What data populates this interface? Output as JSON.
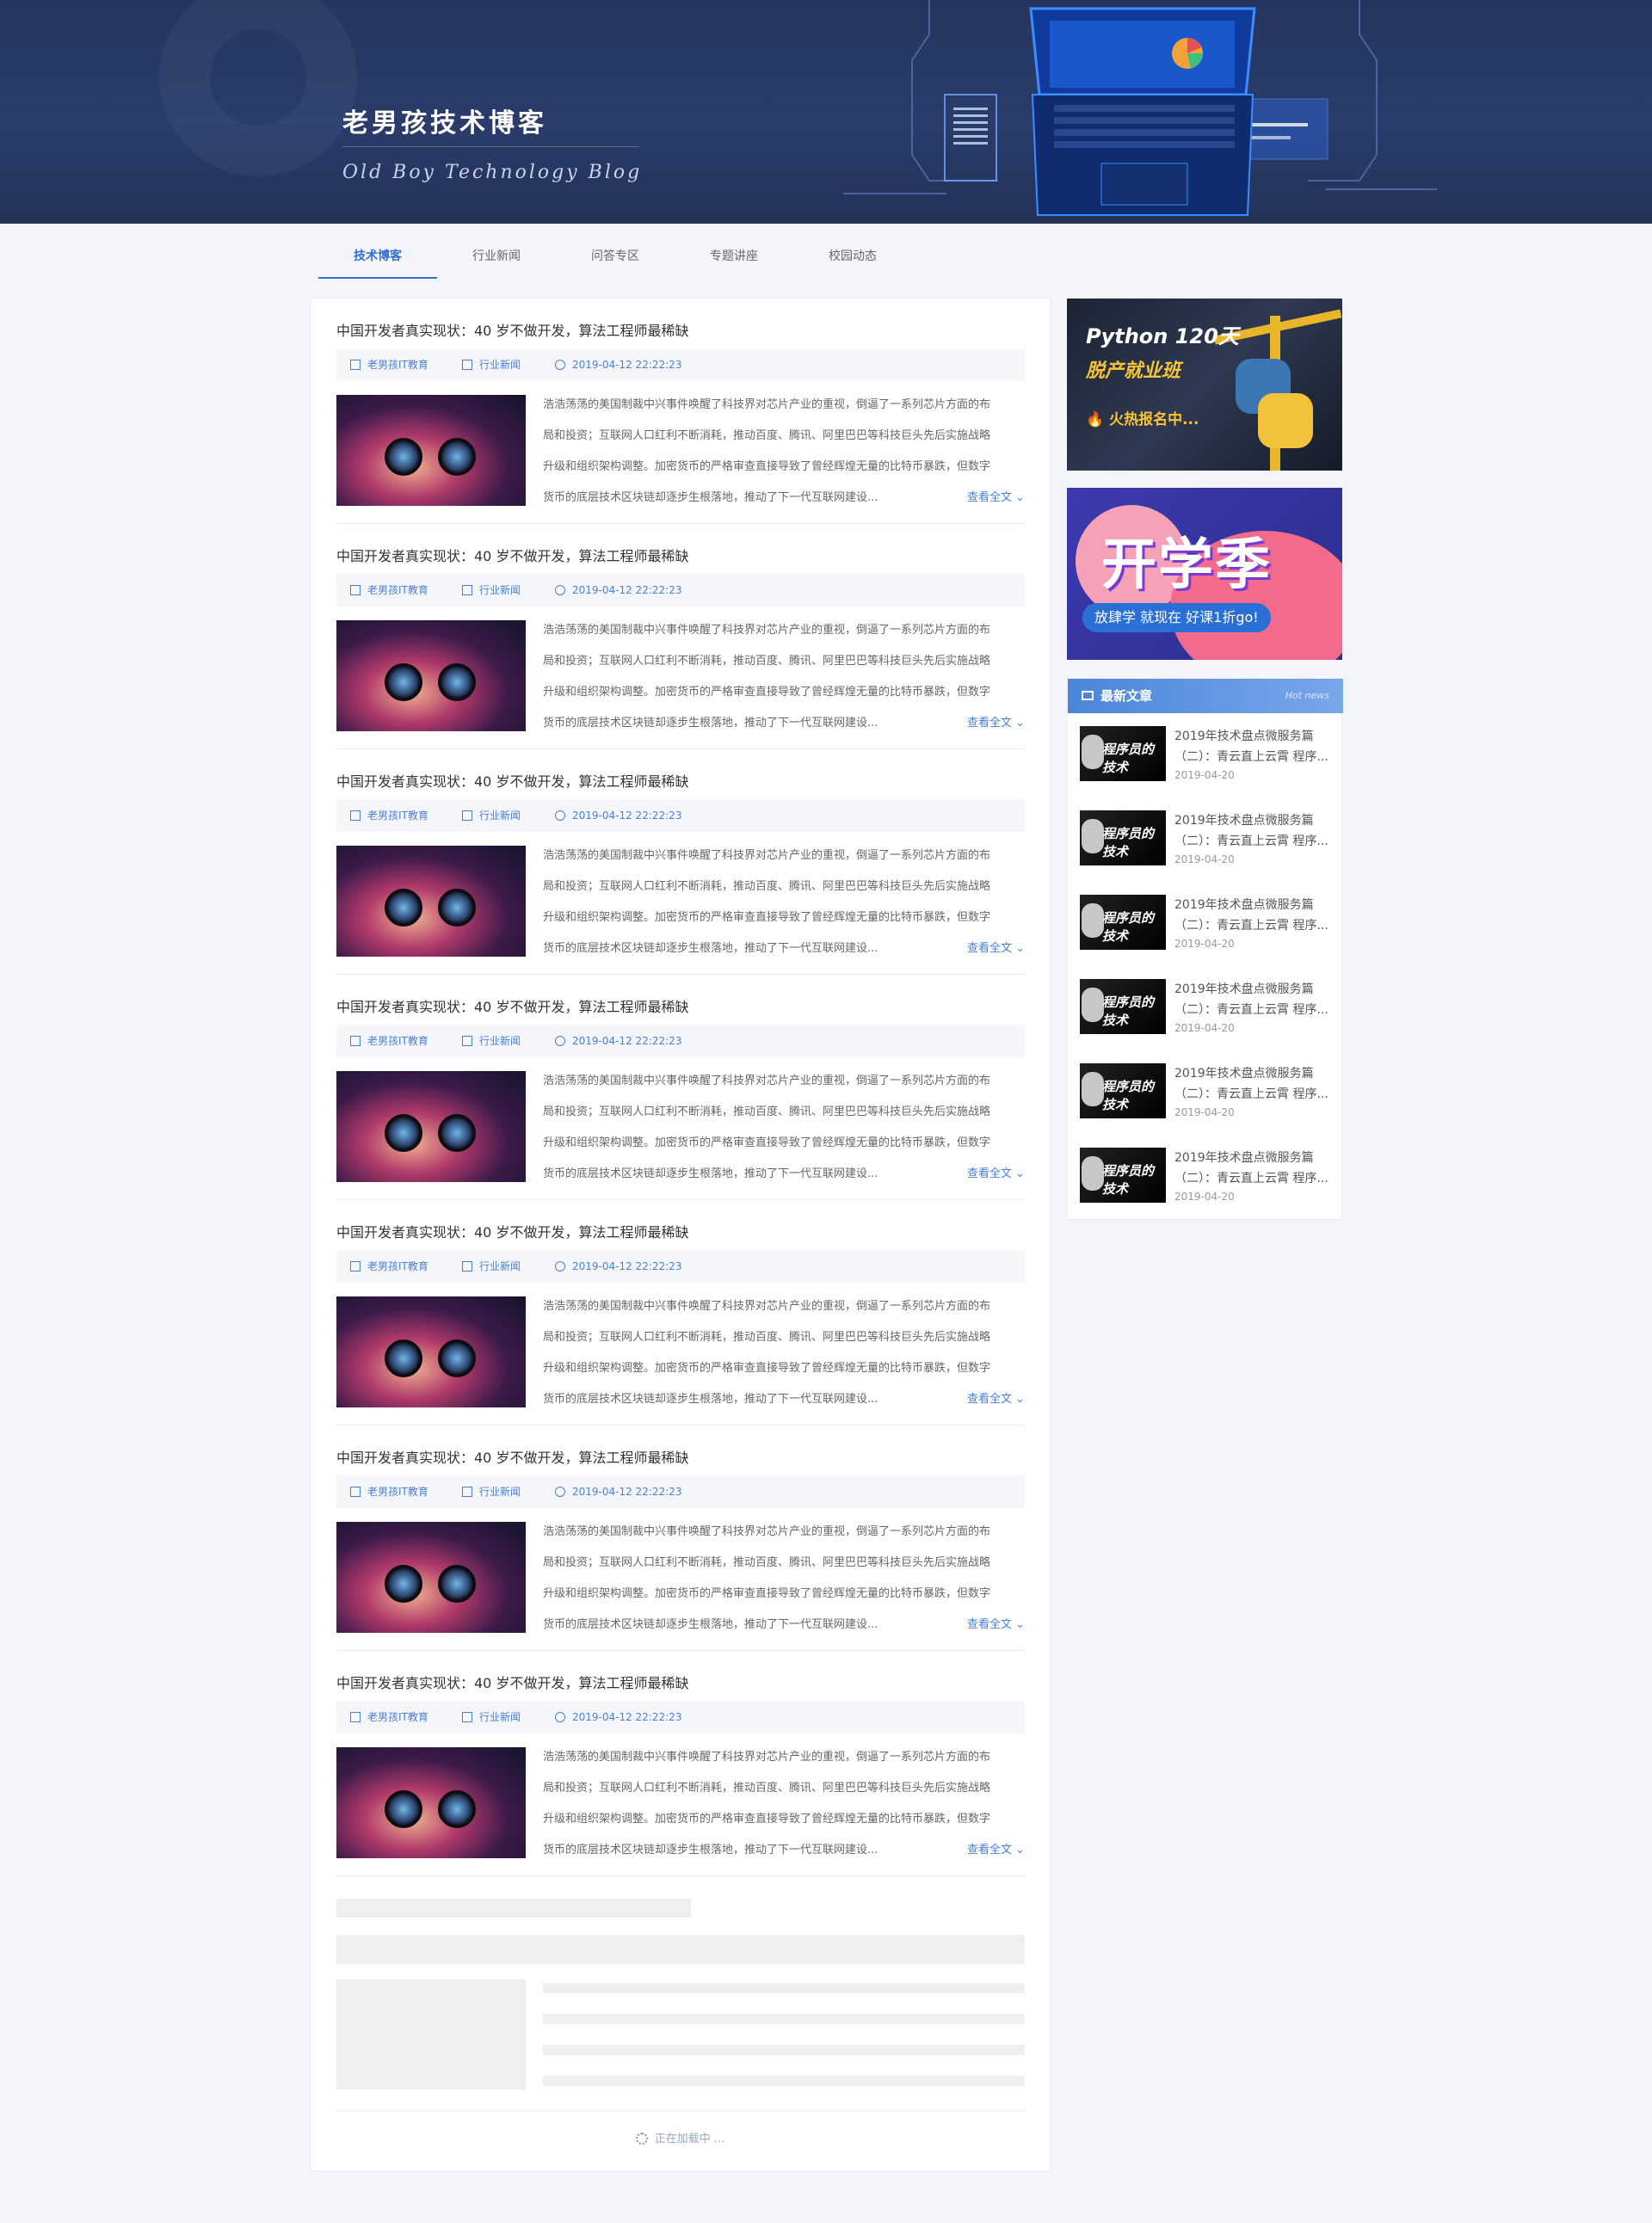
{
  "header": {
    "title": "老男孩技术博客",
    "subtitle": "Old Boy Technology Blog"
  },
  "nav": {
    "items": [
      "技术博客",
      "行业新闻",
      "问答专区",
      "专题讲座",
      "校园动态"
    ],
    "active": "技术博客"
  },
  "articles": [
    {
      "title": "中国开发者真实现状：40 岁不做开发，算法工程师最稀缺",
      "author": "老男孩IT教育",
      "category": "行业新闻",
      "date": "2019-04-12  22:22:23",
      "more": "查看全文",
      "lines": [
        "浩浩荡荡的美国制裁中兴事件唤醒了科技界对芯片产业的重视，倒逼了一系列芯片方面的布",
        "局和投资；互联网人口红利不断消耗，推动百度、腾讯、阿里巴巴等科技巨头先后实施战略",
        "升级和组织架构调整。加密货币的严格审查直接导致了曾经辉煌无量的比特币暴跌，但数字",
        "货币的底层技术区块链却逐步生根落地，推动了下一代互联网建设..."
      ]
    },
    {
      "title": "中国开发者真实现状：40 岁不做开发，算法工程师最稀缺",
      "author": "老男孩IT教育",
      "category": "行业新闻",
      "date": "2019-04-12  22:22:23",
      "more": "查看全文",
      "lines": [
        "浩浩荡荡的美国制裁中兴事件唤醒了科技界对芯片产业的重视，倒逼了一系列芯片方面的布",
        "局和投资；互联网人口红利不断消耗，推动百度、腾讯、阿里巴巴等科技巨头先后实施战略",
        "升级和组织架构调整。加密货币的严格审查直接导致了曾经辉煌无量的比特币暴跌，但数字",
        "货币的底层技术区块链却逐步生根落地，推动了下一代互联网建设..."
      ]
    },
    {
      "title": "中国开发者真实现状：40 岁不做开发，算法工程师最稀缺",
      "author": "老男孩IT教育",
      "category": "行业新闻",
      "date": "2019-04-12  22:22:23",
      "more": "查看全文",
      "lines": [
        "浩浩荡荡的美国制裁中兴事件唤醒了科技界对芯片产业的重视，倒逼了一系列芯片方面的布",
        "局和投资；互联网人口红利不断消耗，推动百度、腾讯、阿里巴巴等科技巨头先后实施战略",
        "升级和组织架构调整。加密货币的严格审查直接导致了曾经辉煌无量的比特币暴跌，但数字",
        "货币的底层技术区块链却逐步生根落地，推动了下一代互联网建设..."
      ]
    },
    {
      "title": "中国开发者真实现状：40 岁不做开发，算法工程师最稀缺",
      "author": "老男孩IT教育",
      "category": "行业新闻",
      "date": "2019-04-12  22:22:23",
      "more": "查看全文",
      "lines": [
        "浩浩荡荡的美国制裁中兴事件唤醒了科技界对芯片产业的重视，倒逼了一系列芯片方面的布",
        "局和投资；互联网人口红利不断消耗，推动百度、腾讯、阿里巴巴等科技巨头先后实施战略",
        "升级和组织架构调整。加密货币的严格审查直接导致了曾经辉煌无量的比特币暴跌，但数字",
        "货币的底层技术区块链却逐步生根落地，推动了下一代互联网建设..."
      ]
    },
    {
      "title": "中国开发者真实现状：40 岁不做开发，算法工程师最稀缺",
      "author": "老男孩IT教育",
      "category": "行业新闻",
      "date": "2019-04-12  22:22:23",
      "more": "查看全文",
      "lines": [
        "浩浩荡荡的美国制裁中兴事件唤醒了科技界对芯片产业的重视，倒逼了一系列芯片方面的布",
        "局和投资；互联网人口红利不断消耗，推动百度、腾讯、阿里巴巴等科技巨头先后实施战略",
        "升级和组织架构调整。加密货币的严格审查直接导致了曾经辉煌无量的比特币暴跌，但数字",
        "货币的底层技术区块链却逐步生根落地，推动了下一代互联网建设..."
      ]
    },
    {
      "title": "中国开发者真实现状：40 岁不做开发，算法工程师最稀缺",
      "author": "老男孩IT教育",
      "category": "行业新闻",
      "date": "2019-04-12  22:22:23",
      "more": "查看全文",
      "lines": [
        "浩浩荡荡的美国制裁中兴事件唤醒了科技界对芯片产业的重视，倒逼了一系列芯片方面的布",
        "局和投资；互联网人口红利不断消耗，推动百度、腾讯、阿里巴巴等科技巨头先后实施战略",
        "升级和组织架构调整。加密货币的严格审查直接导致了曾经辉煌无量的比特币暴跌，但数字",
        "货币的底层技术区块链却逐步生根落地，推动了下一代互联网建设..."
      ]
    },
    {
      "title": "中国开发者真实现状：40 岁不做开发，算法工程师最稀缺",
      "author": "老男孩IT教育",
      "category": "行业新闻",
      "date": "2019-04-12  22:22:23",
      "more": "查看全文",
      "lines": [
        "浩浩荡荡的美国制裁中兴事件唤醒了科技界对芯片产业的重视，倒逼了一系列芯片方面的布",
        "局和投资；互联网人口红利不断消耗，推动百度、腾讯、阿里巴巴等科技巨头先后实施战略",
        "升级和组织架构调整。加密货币的严格审查直接导致了曾经辉煌无量的比特币暴跌，但数字",
        "货币的底层技术区块链却逐步生根落地，推动了下一代互联网建设..."
      ]
    }
  ],
  "loading": "正在加载中 ...",
  "ads": {
    "python": {
      "line1": "Python 120天",
      "line2": "脱产就业班",
      "line3": "🔥 火热报名中..."
    },
    "school": {
      "headline": "开学季",
      "pill": "放肆学 就现在 好课1折go!"
    }
  },
  "hot": {
    "title": "最新文章",
    "title_en": "Hot news",
    "thumb_text": "程序员的技术",
    "items": [
      {
        "title": "2019年技术盘点微服务篇（二）：青云直上云霄  程序...",
        "date": "2019-04-20"
      },
      {
        "title": "2019年技术盘点微服务篇（二）：青云直上云霄  程序...",
        "date": "2019-04-20"
      },
      {
        "title": "2019年技术盘点微服务篇（二）：青云直上云霄  程序...",
        "date": "2019-04-20"
      },
      {
        "title": "2019年技术盘点微服务篇（二）：青云直上云霄  程序...",
        "date": "2019-04-20"
      },
      {
        "title": "2019年技术盘点微服务篇（二）：青云直上云霄  程序...",
        "date": "2019-04-20"
      },
      {
        "title": "2019年技术盘点微服务篇（二）：青云直上云霄  程序...",
        "date": "2019-04-20"
      }
    ]
  },
  "colors": {
    "accent": "#2f6fd2",
    "banner": "#26355e",
    "link": "#4a7fd6"
  }
}
